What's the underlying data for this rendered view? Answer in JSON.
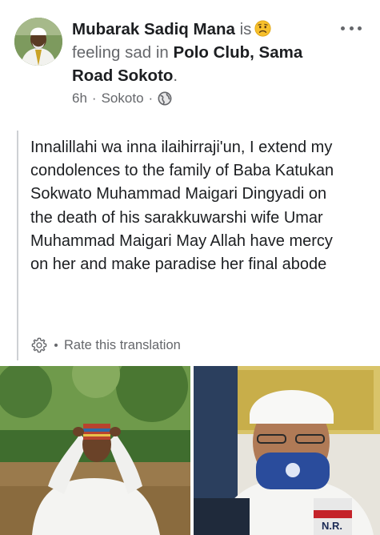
{
  "post": {
    "author_name": "Mubarak Sadiq Mana",
    "is_text": "is",
    "feeling_text": "feeling sad in",
    "place": "Polo Club, Sama Road Sokoto",
    "period": ".",
    "time": "6h",
    "separator": "·",
    "location": "Sokoto",
    "privacy_icon": "globe-icon",
    "feeling_icon": "sad-face-emoji-icon",
    "menu_icon": "more-options-icon",
    "body": "Innalillahi wa inna ilaihirraji'un, I extend my condolences to the family of Baba Katukan Sokwato Muhammad Maigari Dingyadi on the death of his sarakkuwarshi wife Umar Muhammad Maigari May Allah have mercy on her and make paradise her final abode",
    "translate_icon": "gear-icon",
    "translate_label": "Rate this translation",
    "photo_right_caption": "N.R."
  },
  "colors": {
    "text": "#1c1e21",
    "muted": "#65676b",
    "quote_bar": "#ced0d4",
    "background": "#ffffff"
  }
}
